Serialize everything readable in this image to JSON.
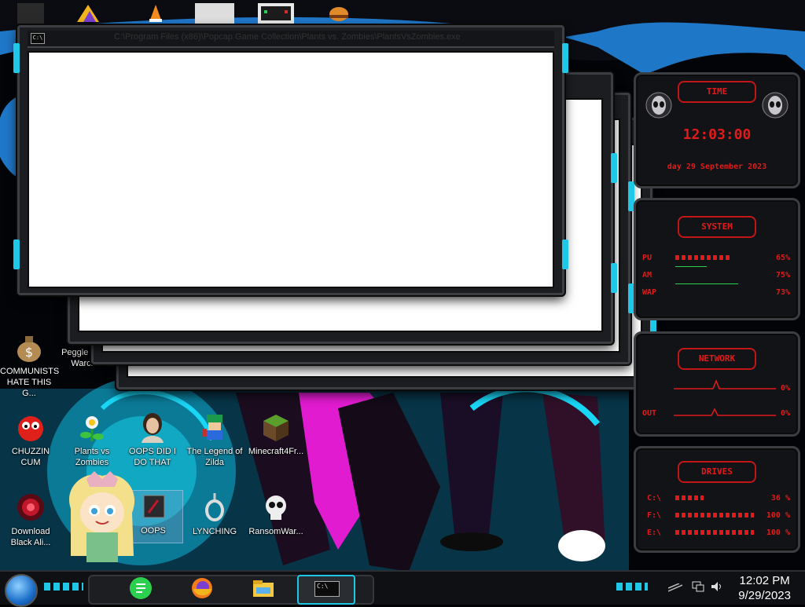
{
  "window": {
    "title": "C:\\Program Files (x86)\\Popcap Game Collection\\Plants vs. Zombies\\PlantsVsZombies.exe",
    "cmd_icon": "C:\\"
  },
  "desktop_icons": [
    {
      "label": "COMMUNISTS HATE THIS G...",
      "icon": "money-bag-icon"
    },
    {
      "label": "Peggle Wo of Warcraft",
      "icon": "peggle-icon"
    },
    {
      "label": "CHUZZIN CUM",
      "icon": "chuzzle-icon"
    },
    {
      "label": "Plants vs Zombies",
      "icon": "flower-icon"
    },
    {
      "label": "OOPS DID I DO THAT",
      "icon": "portrait-icon"
    },
    {
      "label": "The Legend of Zilda",
      "icon": "pixel-hero-icon"
    },
    {
      "label": "Minecraft4Fr...",
      "icon": "grass-block-icon"
    },
    {
      "label": "Download Black Ali...",
      "icon": "alienware-orb-icon"
    },
    {
      "label": "OOPS",
      "icon": "shortcut-box-icon"
    },
    {
      "label": "LYNCHING",
      "icon": "noose-icon"
    },
    {
      "label": "RansomWar...",
      "icon": "skull-icon"
    }
  ],
  "gadget": {
    "time_label": "TIME",
    "time": "12:03:00",
    "date": "day 29 September 2023",
    "system_label": "SYSTEM",
    "system_rows": [
      {
        "label": "PU",
        "value": "65%",
        "level": 0.65
      },
      {
        "label": "AM",
        "value": "75%",
        "level": 0.75
      },
      {
        "label": "WAP",
        "value": "73%",
        "level": 0.73
      }
    ],
    "network_label": "NETWORK",
    "network_rows": [
      {
        "label": "",
        "value": "0%"
      },
      {
        "label": "OUT",
        "value": "0%"
      }
    ],
    "drives_label": "DRIVES",
    "drives_rows": [
      {
        "label": "C:\\",
        "value": "36 %",
        "level": 0.36
      },
      {
        "label": "F:\\",
        "value": "100 %",
        "level": 1.0
      },
      {
        "label": "E:\\",
        "value": "100 %",
        "level": 1.0
      }
    ]
  },
  "taskbar": {
    "start": "start-orb-icon",
    "apps": [
      "notes-icon",
      "firefox-icon",
      "file-explorer-icon",
      "cmd-icon"
    ],
    "cmd_label": "C:\\",
    "clock_time": "12:02 PM",
    "clock_date": "9/29/2023"
  },
  "colors": {
    "accent_cyan": "#1ec8e6",
    "gadget_red": "#e01b1b",
    "window_frame": "#3b3e43"
  }
}
